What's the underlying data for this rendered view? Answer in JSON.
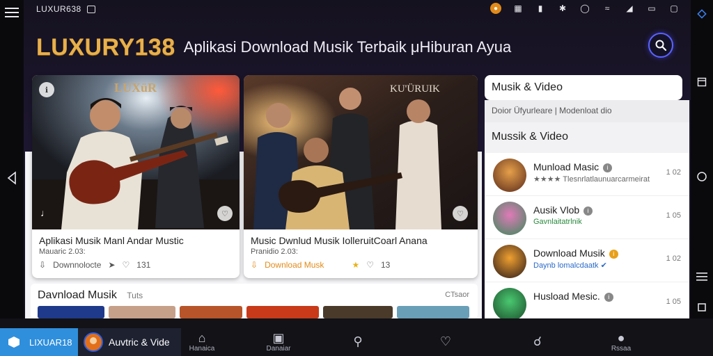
{
  "status": {
    "app_label": "LUXUR638"
  },
  "header": {
    "brand": "LUXURY138",
    "tagline": "Aplikasi Download Musik Terbaik μHiburan Ayua"
  },
  "cards": [
    {
      "overlay": "LUXüR",
      "title": "Aplikasi Musik Manl Andar Mustic",
      "sub": "Mauaric 2.03:",
      "meta_label": "Downnolocte",
      "meta_count": "131",
      "badge_left": "ℹ",
      "badge_right": "♡"
    },
    {
      "overlay": "KU'ÜRUIK",
      "title": "Music Dwnlud Musik IolleruitCoarl Anana",
      "sub": "Pranidio 2.03:",
      "meta_label": "Download Musk",
      "meta_count": "13",
      "badge_right": "♡"
    }
  ],
  "section": {
    "title": "Davnload Musik",
    "sub": "Tuts",
    "right": "CTsaor"
  },
  "sidebar": {
    "header": "Musik & Video",
    "tabs_text": "Doior Üfyurleare  |  Modenloat dio",
    "section": "Mussik & Video",
    "items": [
      {
        "name": "Munload Masic",
        "sub": "★★★★ Tlesnrlatlaunuarcarmeirat",
        "count": "1 02"
      },
      {
        "name": "Ausik Vlob",
        "sub": "Gavnlaitatrlnik",
        "count": "1 05"
      },
      {
        "name": "Download Musik",
        "sub": "Daynb lomalcdaatk ✔",
        "count": "1 02"
      },
      {
        "name": "Husload Mesic.",
        "sub": "",
        "count": "1 05"
      }
    ]
  },
  "bottom": {
    "active_tab": "LIXUAR18",
    "secondary_tab": "Auvtric & Vide",
    "nav": [
      {
        "icon": "home-icon",
        "label": "Hanaica"
      },
      {
        "icon": "download-icon",
        "label": "Danaiar"
      },
      {
        "icon": "search-icon",
        "label": ""
      },
      {
        "icon": "heart-icon",
        "label": ""
      },
      {
        "icon": "explore-icon",
        "label": ""
      },
      {
        "icon": "profile-icon",
        "label": "Rssaa"
      }
    ]
  },
  "colors": {
    "brand": "#e9b04a",
    "accent": "#2f8fdc",
    "search_ring": "#5a63ff",
    "background": "#15121f"
  }
}
